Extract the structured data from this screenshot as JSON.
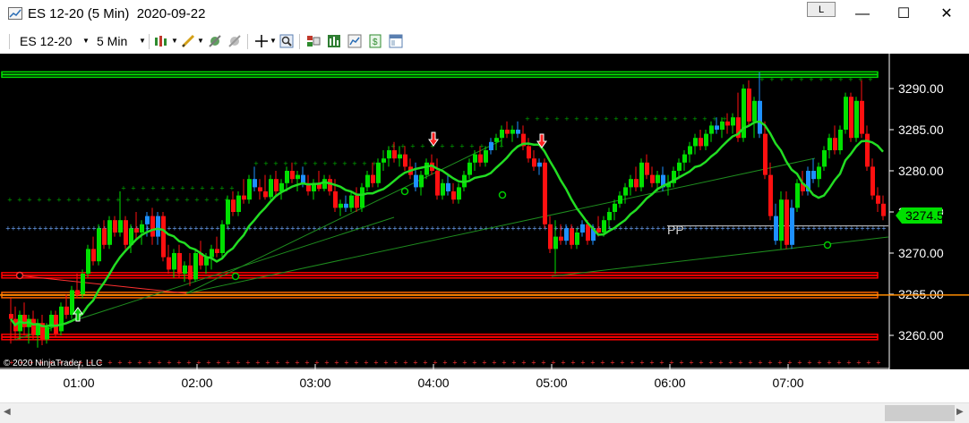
{
  "window": {
    "title": "ES 12-20 (5 Min)  2020-09-22",
    "link_label": "L",
    "minimize": "—",
    "maximize": "☐",
    "close": "✕"
  },
  "toolbar": {
    "instrument": "ES 12-20",
    "interval": "5 Min",
    "icons": [
      "chart-style-icon",
      "drawing-tool-icon",
      "strategy-icon",
      "indicator-icon",
      "crosshair-icon",
      "zoom-icon",
      "data-box-icon",
      "bar-chart-icon",
      "chart-trader-icon",
      "price-icon",
      "properties-icon"
    ]
  },
  "chart": {
    "copyright": "© 2020 NinjaTrader, LLC",
    "pivot_label": "PP",
    "last_price_label": "3274.50",
    "colors": {
      "up_candle": "#00e000",
      "down_candle": "#ff1010",
      "doji_candle": "#1e90ff",
      "moving_average": "#22dd22",
      "support_lines": "#ff0000",
      "resistance_line": "#00dd00",
      "pivot_line": "#d0d0d0"
    }
  },
  "chart_data": {
    "type": "candlestick",
    "title": "ES 12-20 (5 Min)",
    "ylim": [
      3256.4,
      3293.8
    ],
    "y_ticks": [
      "3290.00",
      "3285.00",
      "3280.00",
      "3275.00",
      "3270.00",
      "3265.00",
      "3260.00"
    ],
    "x_ticks": [
      "01:00",
      "02:00",
      "03:00",
      "04:00",
      "05:00",
      "06:00",
      "07:00"
    ],
    "last_price": 3274.5,
    "pivot": 3273.3,
    "horizontal_lines": [
      {
        "price": 3291.7,
        "color": "#00dd00"
      },
      {
        "price": 3267.3,
        "color": "#ff0000"
      },
      {
        "price": 3264.9,
        "color": "#ff6600"
      },
      {
        "price": 3259.8,
        "color": "#ff0000"
      }
    ]
  }
}
